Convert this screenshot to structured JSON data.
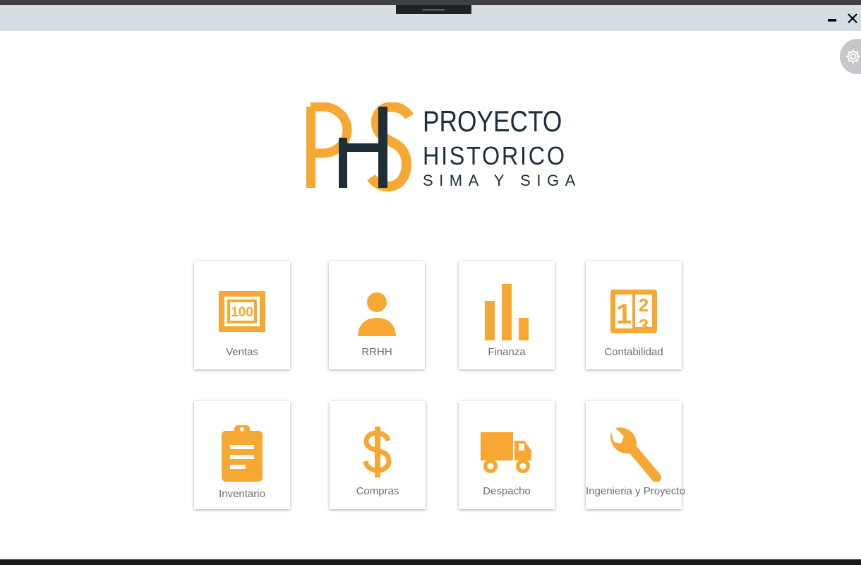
{
  "window": {
    "minimize_icon": "minimize-icon",
    "close_icon": "close-icon",
    "settings_icon": "gear-icon"
  },
  "logo": {
    "monogram": "PHS",
    "line1": "PROYECTO",
    "line2": "HISTORICO",
    "line3": "SIMA Y SIGA"
  },
  "colors": {
    "accent": "#f6a833",
    "dark": "#1f2f3a",
    "titlebar": "#d6dde3"
  },
  "modules": [
    {
      "label": "Ventas",
      "icon": "banknote-icon"
    },
    {
      "label": "RRHH",
      "icon": "person-icon"
    },
    {
      "label": "Finanza",
      "icon": "bar-chart-icon"
    },
    {
      "label": "Contabilidad",
      "icon": "numbers-icon"
    },
    {
      "label": "Inventario",
      "icon": "clipboard-icon"
    },
    {
      "label": "Compras",
      "icon": "dollar-icon"
    },
    {
      "label": "Despacho",
      "icon": "truck-icon"
    },
    {
      "label": "Ingenieria y Proyecto",
      "icon": "wrench-icon"
    }
  ]
}
